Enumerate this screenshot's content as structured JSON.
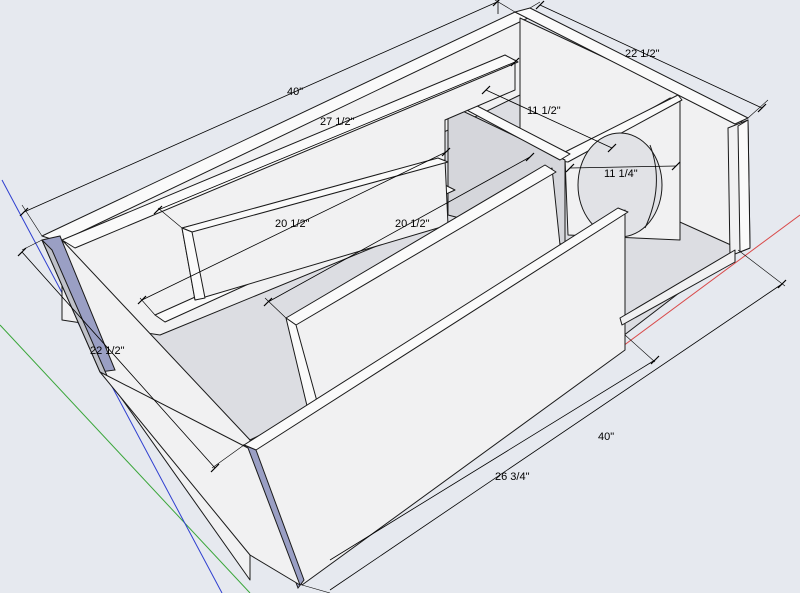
{
  "scene": {
    "background": "#e6e9ef",
    "axis_colors": {
      "red": "#d94a4a",
      "green": "#3aa63a",
      "blue": "#2f3fd0"
    }
  },
  "dimensions": {
    "top_length": "40\"",
    "top_depth": "22 1/2\"",
    "divider_long": "27 1/2\"",
    "chamber_width": "11 1/2\"",
    "port_width": "11 1/4\"",
    "baffle_left": "20 1/2\"",
    "baffle_right": "20 1/2\"",
    "side_depth": "22 1/2\"",
    "bottom_length": "40\"",
    "front_length": "26 3/4\""
  }
}
